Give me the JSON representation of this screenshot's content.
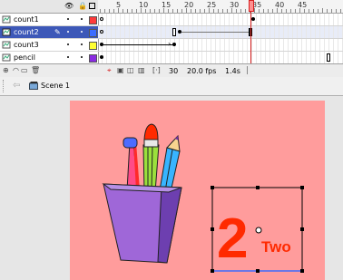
{
  "colors": {
    "stage": "#ff9c9c",
    "selected_layer": "#3d58b8",
    "playhead": "#d62020",
    "two_text": "#ff2a00"
  },
  "timeline": {
    "header_icons": [
      "eye-icon",
      "lock-icon",
      "outline-icon"
    ],
    "ruler_numbers": [
      "5",
      "10",
      "15",
      "20",
      "25",
      "30",
      "35",
      "40",
      "45"
    ],
    "current_frame": "30",
    "layers": [
      {
        "name": "count1",
        "swatch": "#ff3b3b",
        "selected": false
      },
      {
        "name": "count2",
        "swatch": "#3b6cff",
        "selected": true
      },
      {
        "name": "count3",
        "swatch": "#ffff33",
        "selected": false
      },
      {
        "name": "pencil",
        "swatch": "#8a2be2",
        "selected": false
      }
    ],
    "status": {
      "frame": "30",
      "fps": "20.0 fps",
      "time": "1.4s"
    }
  },
  "editbar": {
    "scene": "Scene 1"
  },
  "stage": {
    "number_text": "2",
    "word_text": "Two"
  }
}
